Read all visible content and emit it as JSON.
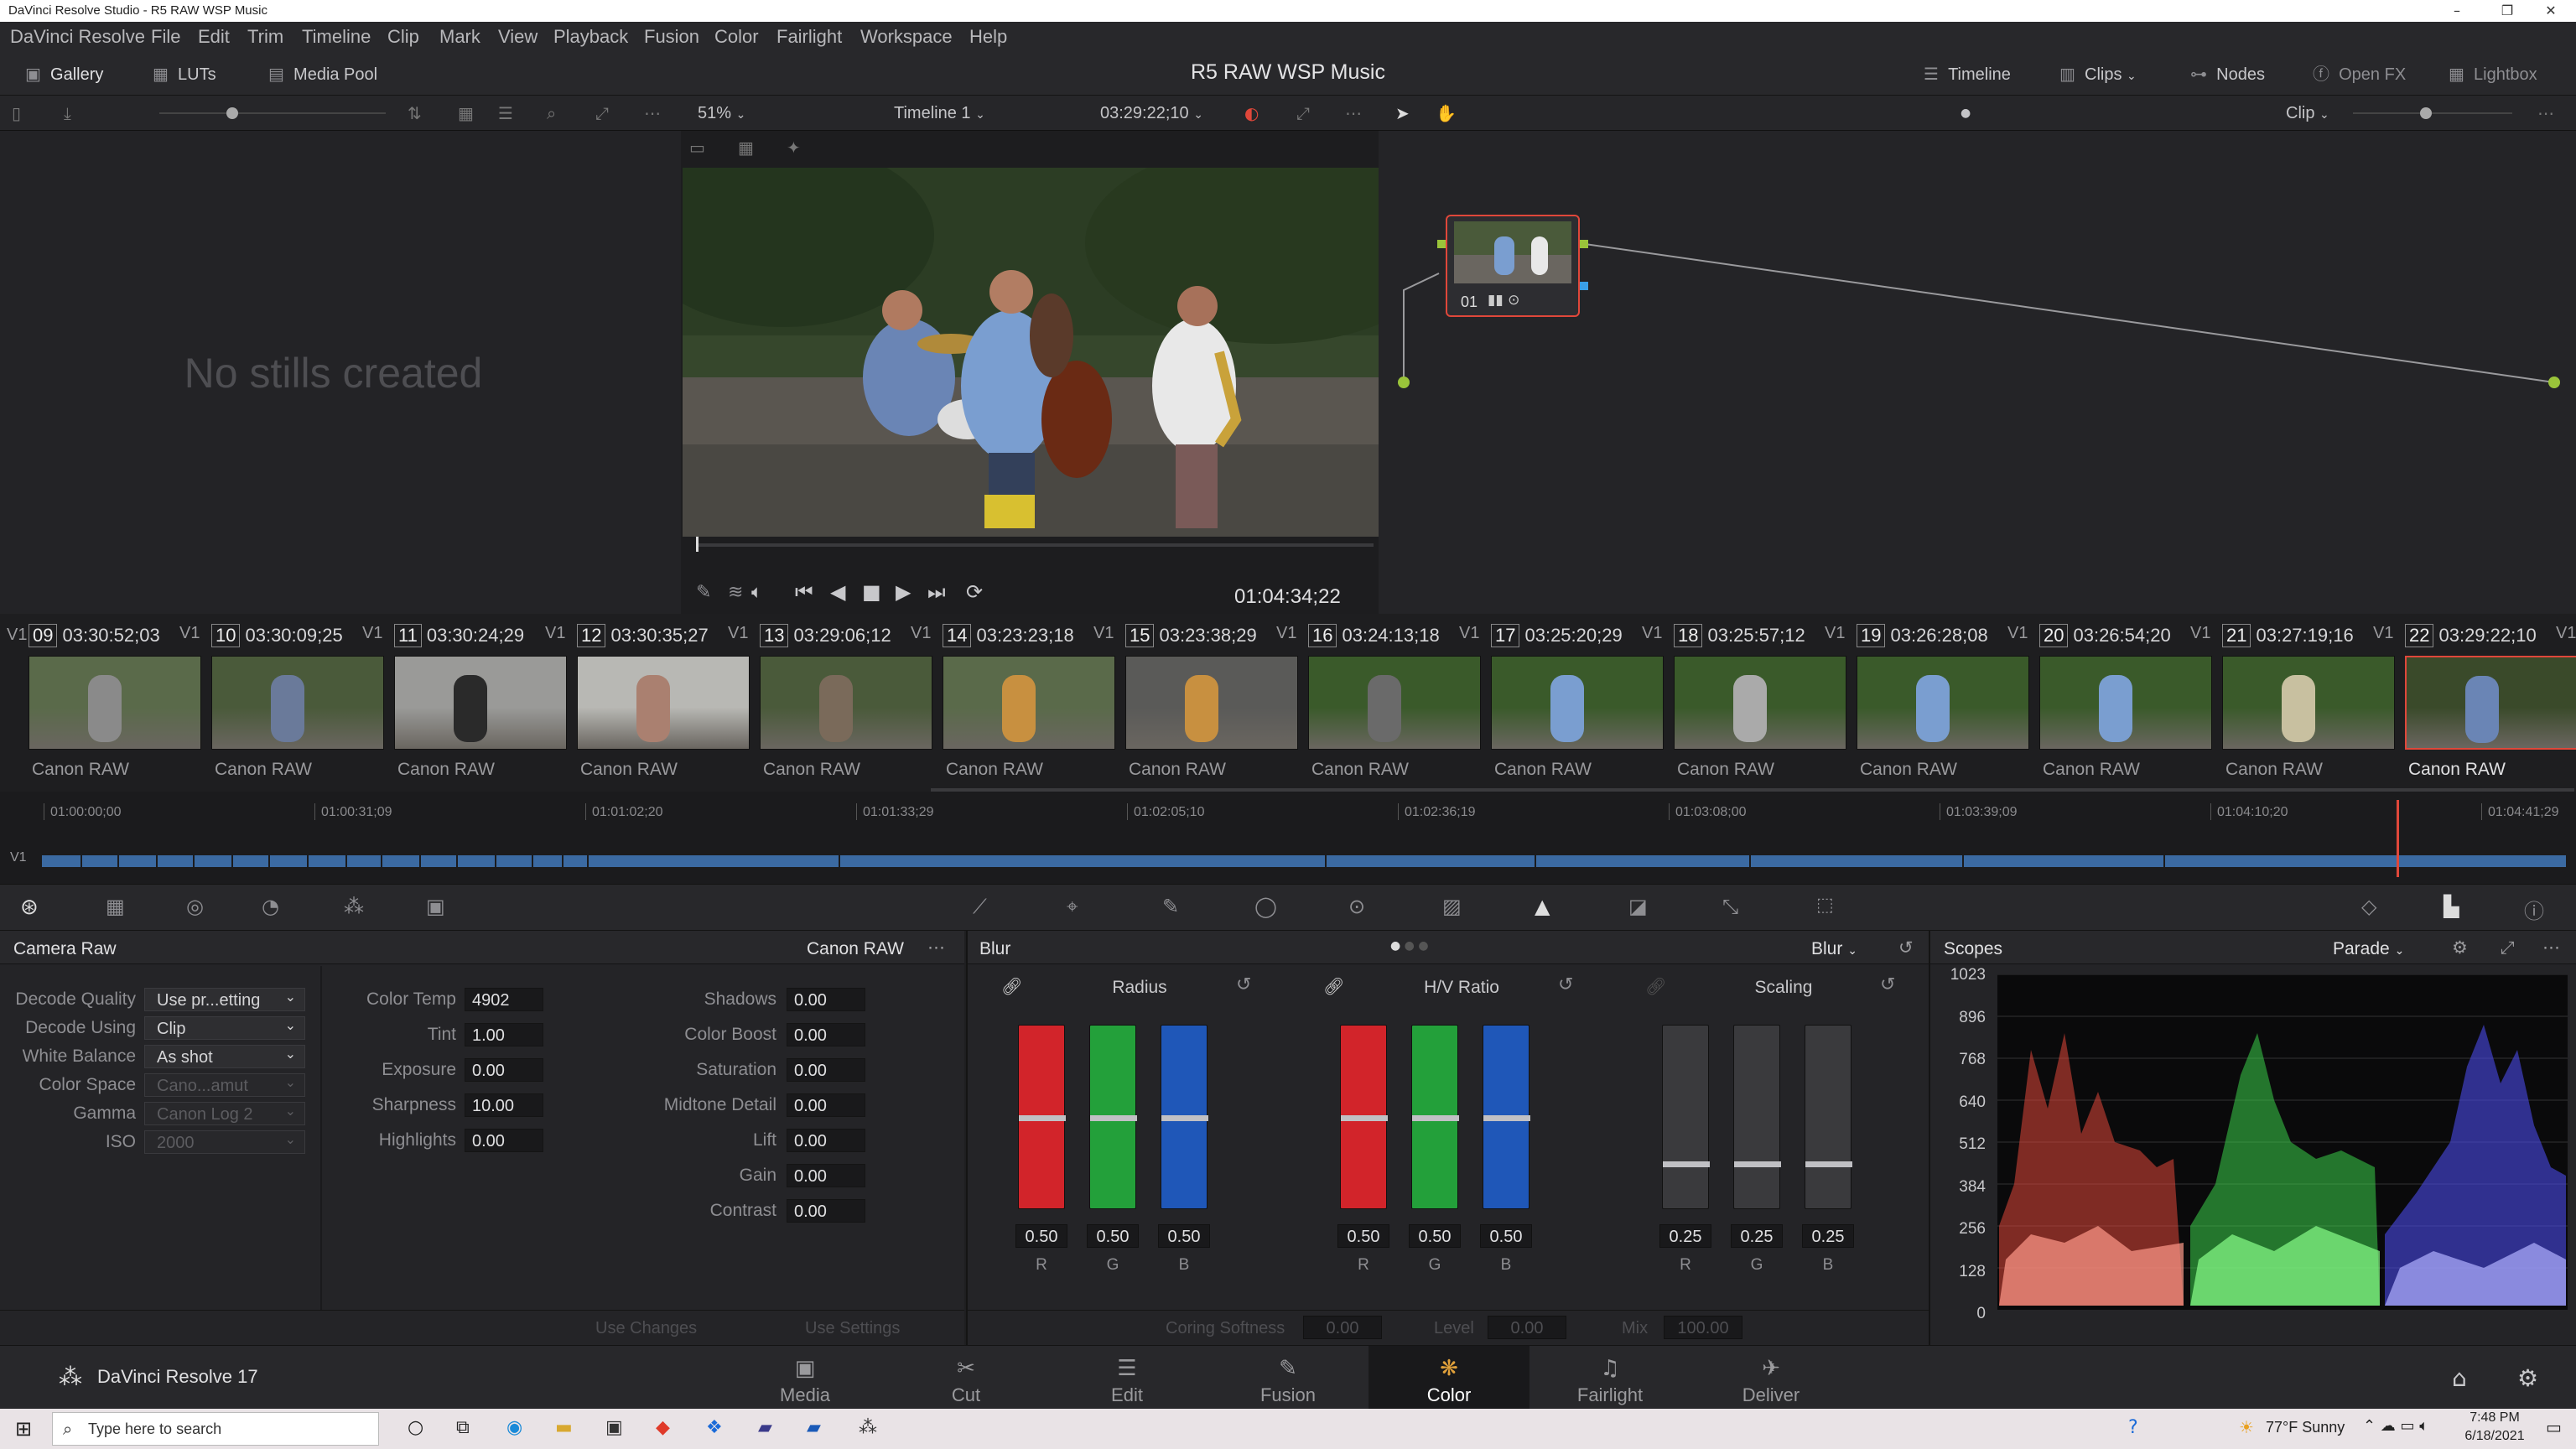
{
  "window": {
    "title": "DaVinci Resolve Studio - R5 RAW WSP Music"
  },
  "menu": [
    "DaVinci Resolve",
    "File",
    "Edit",
    "Trim",
    "Timeline",
    "Clip",
    "Mark",
    "View",
    "Playback",
    "Fusion",
    "Color",
    "Fairlight",
    "Workspace",
    "Help"
  ],
  "toolbar": {
    "gallery": "Gallery",
    "luts": "LUTs",
    "media_pool": "Media Pool",
    "project_title": "R5 RAW WSP Music",
    "timeline": "Timeline",
    "clips": "Clips",
    "nodes": "Nodes",
    "openfx": "Open FX",
    "lightbox": "Lightbox"
  },
  "viewerbar": {
    "zoom": "51%",
    "timeline_name": "Timeline 1",
    "timecode": "03:29:22;10",
    "mode": "Clip"
  },
  "gallery": {
    "empty": "No stills created"
  },
  "viewer": {
    "timecode": "01:04:34;22"
  },
  "node": {
    "label": "01"
  },
  "clips": [
    {
      "num": "09",
      "tc": "03:30:52;03",
      "track": "V1",
      "codec": "Canon RAW"
    },
    {
      "num": "10",
      "tc": "03:30:09;25",
      "track": "V1",
      "codec": "Canon RAW"
    },
    {
      "num": "11",
      "tc": "03:30:24;29",
      "track": "V1",
      "codec": "Canon RAW"
    },
    {
      "num": "12",
      "tc": "03:30:35;27",
      "track": "V1",
      "codec": "Canon RAW"
    },
    {
      "num": "13",
      "tc": "03:29:06;12",
      "track": "V1",
      "codec": "Canon RAW"
    },
    {
      "num": "14",
      "tc": "03:23:23;18",
      "track": "V1",
      "codec": "Canon RAW"
    },
    {
      "num": "15",
      "tc": "03:23:38;29",
      "track": "V1",
      "codec": "Canon RAW"
    },
    {
      "num": "16",
      "tc": "03:24:13;18",
      "track": "V1",
      "codec": "Canon RAW"
    },
    {
      "num": "17",
      "tc": "03:25:20;29",
      "track": "V1",
      "codec": "Canon RAW"
    },
    {
      "num": "18",
      "tc": "03:25:57;12",
      "track": "V1",
      "codec": "Canon RAW"
    },
    {
      "num": "19",
      "tc": "03:26:28;08",
      "track": "V1",
      "codec": "Canon RAW"
    },
    {
      "num": "20",
      "tc": "03:26:54;20",
      "track": "V1",
      "codec": "Canon RAW"
    },
    {
      "num": "21",
      "tc": "03:27:19;16",
      "track": "V1",
      "codec": "Canon RAW"
    },
    {
      "num": "22",
      "tc": "03:29:22;10",
      "track": "V1",
      "codec": "Canon RAW"
    }
  ],
  "strip_prefix": "V1",
  "timeline": {
    "ticks": [
      "01:00:00;00",
      "01:00:31;09",
      "01:01:02;20",
      "01:01:33;29",
      "01:02:05;10",
      "01:02:36;19",
      "01:03:08;00",
      "01:03:39;09",
      "01:04:10;20",
      "01:04:41;29"
    ],
    "track": "V1"
  },
  "camera_raw": {
    "title": "Camera Raw",
    "source": "Canon RAW",
    "col1": [
      {
        "label": "Decode Quality",
        "value": "Use pr...etting",
        "disabled": false
      },
      {
        "label": "Decode Using",
        "value": "Clip",
        "disabled": false
      },
      {
        "label": "White Balance",
        "value": "As shot",
        "disabled": false
      },
      {
        "label": "Color Space",
        "value": "Cano...amut",
        "disabled": true
      },
      {
        "label": "Gamma",
        "value": "Canon Log 2",
        "disabled": true
      },
      {
        "label": "ISO",
        "value": "2000",
        "disabled": true
      }
    ],
    "col2": [
      {
        "label": "Color Temp",
        "value": "4902"
      },
      {
        "label": "Tint",
        "value": "1.00"
      },
      {
        "label": "Exposure",
        "value": "0.00"
      },
      {
        "label": "Sharpness",
        "value": "10.00"
      },
      {
        "label": "Highlights",
        "value": "0.00"
      }
    ],
    "col3": [
      {
        "label": "Shadows",
        "value": "0.00"
      },
      {
        "label": "Color Boost",
        "value": "0.00"
      },
      {
        "label": "Saturation",
        "value": "0.00"
      },
      {
        "label": "Midtone Detail",
        "value": "0.00"
      },
      {
        "label": "Lift",
        "value": "0.00"
      },
      {
        "label": "Gain",
        "value": "0.00"
      },
      {
        "label": "Contrast",
        "value": "0.00"
      }
    ],
    "use_changes": "Use Changes",
    "use_settings": "Use Settings"
  },
  "blur": {
    "title": "Blur",
    "mode": "Blur",
    "groups": [
      {
        "name": "Radius",
        "values": [
          "0.50",
          "0.50",
          "0.50"
        ],
        "level": 0.5,
        "colored": true
      },
      {
        "name": "H/V Ratio",
        "values": [
          "0.50",
          "0.50",
          "0.50"
        ],
        "level": 0.5,
        "colored": true
      },
      {
        "name": "Scaling",
        "values": [
          "0.25",
          "0.25",
          "0.25"
        ],
        "level": 0.25,
        "colored": false
      }
    ],
    "channels": [
      "R",
      "G",
      "B"
    ],
    "coring_label": "Coring Softness",
    "coring": "0.00",
    "level_label": "Level",
    "level": "0.00",
    "mix_label": "Mix",
    "mix": "100.00"
  },
  "scopes": {
    "title": "Scopes",
    "mode": "Parade",
    "scale": [
      "1023",
      "896",
      "768",
      "640",
      "512",
      "384",
      "256",
      "128",
      "0"
    ]
  },
  "pages": {
    "app": "DaVinci Resolve 17",
    "items": [
      "Media",
      "Cut",
      "Edit",
      "Fusion",
      "Color",
      "Fairlight",
      "Deliver"
    ],
    "active": "Color"
  },
  "taskbar": {
    "search_placeholder": "Type here to search",
    "weather": "77°F  Sunny",
    "time": "7:48 PM",
    "date": "6/18/2021"
  },
  "colors": {
    "accent_red": "#e0473a",
    "timeline_blue": "#3b6aa2",
    "panel": "#242427"
  }
}
